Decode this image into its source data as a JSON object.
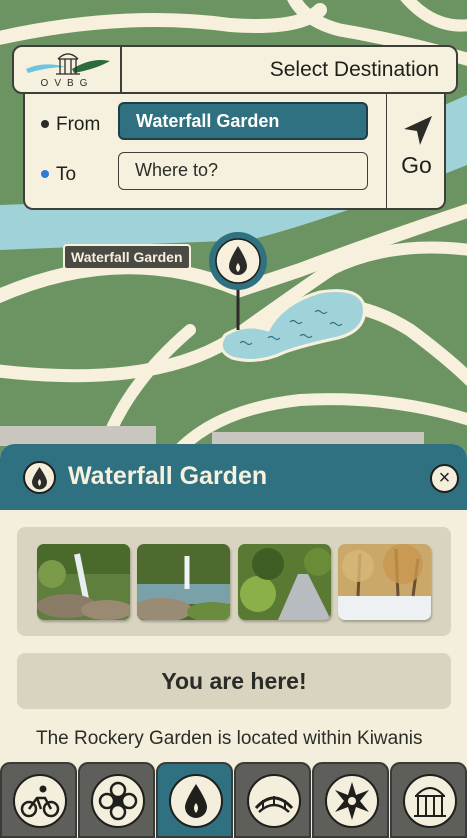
{
  "header": {
    "logo_text": "OVBG",
    "title": "Select Destination"
  },
  "route": {
    "from_label": "From",
    "from_value": "Waterfall Garden",
    "to_label": "To",
    "to_placeholder": "Where to?",
    "go_label": "Go",
    "from_dot_color": "#2b2b28",
    "to_dot_color": "#2f7bd6"
  },
  "map": {
    "marker_label": "Waterfall Garden"
  },
  "sheet": {
    "title": "Waterfall Garden",
    "close_glyph": "×",
    "photos": [
      "waterfall-rocks",
      "fountain-pond",
      "garden-path",
      "winter-trees"
    ],
    "you_are_here": "You are here!",
    "description": "The Rockery Garden is located within Kiwanis Valleyview Park of the Oshawa"
  },
  "tabs": [
    {
      "name": "cycling-icon",
      "active": false
    },
    {
      "name": "flower-icon",
      "active": false
    },
    {
      "name": "water-drop-icon",
      "active": true
    },
    {
      "name": "bridge-icon",
      "active": false
    },
    {
      "name": "star-flower-icon",
      "active": false
    },
    {
      "name": "gazebo-icon",
      "active": false
    }
  ],
  "colors": {
    "primary": "#2f7180",
    "background": "#f4efdc",
    "map_green": "#6b9462",
    "water": "#9fd3d9"
  }
}
